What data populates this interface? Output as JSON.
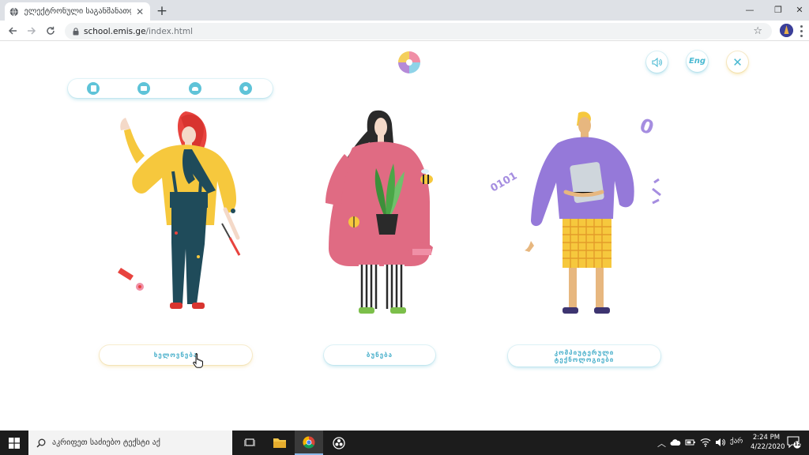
{
  "browser": {
    "tab_title": "ელექტრონული საგანმანათლებლო",
    "tab_close": "✕",
    "new_tab": "+",
    "url_host": "school.emis.ge",
    "url_path": "/index.html",
    "window_controls": {
      "minimize": "—",
      "restore": "❐",
      "close": "✕"
    },
    "bookmark_star": "☆"
  },
  "page": {
    "top_buttons": {
      "sound_icon": "speaker-icon",
      "language": "Eng",
      "close": "✕"
    },
    "iconbar": [
      "document-icon",
      "folder-icon",
      "people-icon",
      "network-icon"
    ],
    "categories": [
      {
        "label": "ხელოვნება",
        "figure": "artist-figure"
      },
      {
        "label": "ბუნება",
        "figure": "nature-figure"
      },
      {
        "label_line1": "კომპიუტერული",
        "label_line2": "ტექნოლოგიები",
        "figure": "tech-figure"
      }
    ],
    "decor_binary_left": "0101",
    "decor_zero": "0"
  },
  "taskbar": {
    "search_placeholder": "აკრიფეთ საძიებო ტექსტი აქ",
    "language": "ქარ",
    "time": "2:24 PM",
    "date": "4/22/2020",
    "notification_count": "12"
  },
  "colors": {
    "accent": "#4ab0cb",
    "taskbar": "#1c1c1c",
    "tab_bg": "#dee1e6"
  }
}
